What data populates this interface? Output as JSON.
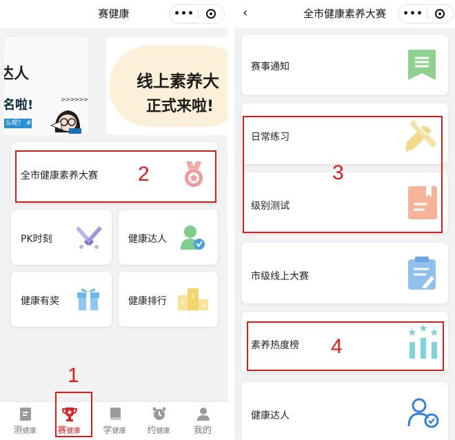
{
  "left": {
    "title": "赛健康",
    "capsule": {
      "more": "•••",
      "close_icon": "target-icon"
    },
    "banner1": {
      "big": "达人",
      "row": "名啦!",
      "strip": "么呢？ #",
      "zz": ">>>>>>"
    },
    "banner2": {
      "line1": "线上素养大",
      "line2": "正式来啦!"
    },
    "main_card": {
      "label": "全市健康素养大赛",
      "icon": "medal-icon",
      "color": "#f19999"
    },
    "grid": [
      {
        "label": "PK时刻",
        "icon": "crossed-swords-icon"
      },
      {
        "label": "健康达人",
        "icon": "user-check-icon"
      },
      {
        "label": "健康有奖",
        "icon": "gift-icon"
      },
      {
        "label": "健康排行",
        "icon": "podium-icon"
      }
    ],
    "tabs": [
      {
        "prefix": "测",
        "suffix": "健康",
        "icon": "clipboard-icon",
        "active": false
      },
      {
        "prefix": "赛",
        "suffix": "健康",
        "icon": "trophy-icon",
        "active": true
      },
      {
        "prefix": "学",
        "suffix": "健康",
        "icon": "book-icon",
        "active": false
      },
      {
        "prefix": "约",
        "suffix": "健康",
        "icon": "alarm-clock-icon",
        "active": false
      },
      {
        "prefix": "我的",
        "suffix": "",
        "icon": "person-icon",
        "active": false
      }
    ]
  },
  "right": {
    "title": "全市健康素养大赛",
    "back": "‹",
    "capsule": {
      "more": "•••",
      "close_icon": "target-icon"
    },
    "cards": [
      {
        "label": "赛事通知",
        "icon": "bookmark-list-icon",
        "color": "#8fd18f"
      },
      {
        "label": "日常练习",
        "icon": "pencils-icon",
        "color": "#f2d98a"
      },
      {
        "label": "级别测试",
        "icon": "book-bookmark-icon",
        "color": "#f5b49a"
      },
      {
        "label": "市级线上大赛",
        "icon": "clipboard-pen-icon",
        "color": "#8fc1ec"
      },
      {
        "label": "素养热度榜",
        "icon": "chart-stars-icon",
        "color": "#7fd4d8"
      },
      {
        "label": "健康达人",
        "icon": "user-check-outline-icon",
        "color": "#2f7ee0"
      }
    ]
  },
  "annotations": [
    "1",
    "2",
    "3",
    "4"
  ],
  "colors": {
    "annotation": "#e01a1a",
    "tab_active": "#e02020"
  }
}
